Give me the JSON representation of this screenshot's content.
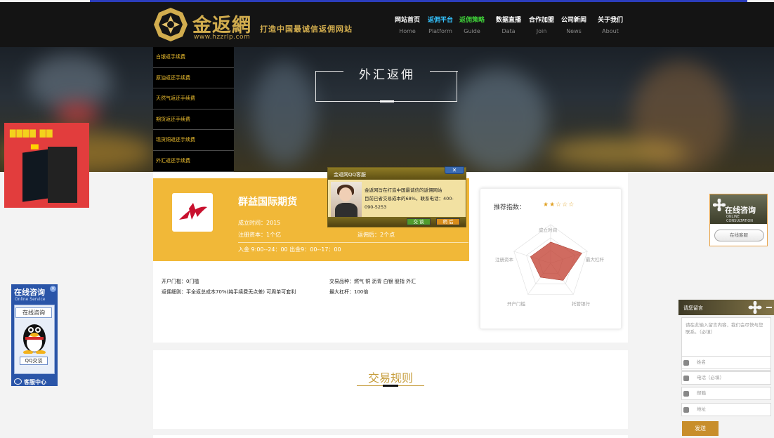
{
  "header": {
    "logo_title": "金返網",
    "logo_url": "www.hzzrlp.com",
    "slogan": "打造中国最诚信返佣网站"
  },
  "nav": [
    {
      "cn": "网站首页",
      "en": "Home"
    },
    {
      "cn": "返佣平台",
      "en": "Platform"
    },
    {
      "cn": "返佣策略",
      "en": "Guide"
    },
    {
      "cn": "数据直播",
      "en": "Data"
    },
    {
      "cn": "合作加盟",
      "en": "Join"
    },
    {
      "cn": "公司新闻",
      "en": "News"
    },
    {
      "cn": "关于我们",
      "en": "About"
    }
  ],
  "hero": {
    "title": "外汇返佣"
  },
  "side_menu": [
    "白银返手续费",
    "原油返还手续费",
    "天然气返还手续费",
    "期货返还手续费",
    "现货铜返还手续费",
    "外汇返还手续费"
  ],
  "company": {
    "name": "群益国际期货",
    "founded": "成立时间：2015",
    "capital": "注册资本：1个亿",
    "rebate": "返佣后：2个点",
    "hours": "入金 9:00--24：00 出金9：00--17：00"
  },
  "details": {
    "threshold": "开户门槛：0门槛",
    "varieties": "交易品种：燃气 铜 沥青 白银 股指 外汇",
    "rules": "返佣细则：平全返总成本70%(纯手续费无点差) 可周单可套利",
    "leverage": "最大杠杆：100倍"
  },
  "radar": {
    "title": "推荐指数：",
    "stars": "★★☆☆☆",
    "labels": [
      "成立时间",
      "最大杠杆",
      "托管银行",
      "开户门槛",
      "注册资本"
    ],
    "values": [
      0.55,
      0.85,
      0.55,
      0.45,
      0.55
    ]
  },
  "rules_section": {
    "title": "交易规则"
  },
  "qq_popup": {
    "title": "金返网QQ客服",
    "line1": "金返网旨在打造中国最诚信的返佣网站",
    "line2": "目前已省交易成本的68%，联系电话：400-090-5253",
    "btn_chat": "交 谈",
    "btn_later": "稍 后"
  },
  "qq_float": {
    "header": "在线咨询",
    "sub": "Online Service",
    "online_btn": "在线咨询",
    "qq_btn": "QQ交谈",
    "footer": "客服中心"
  },
  "right_consult": {
    "title": "在线咨询",
    "sub": "ONLINE CONSULTATION",
    "btn": "在线客服"
  },
  "leave_msg": {
    "title": "请您留言",
    "placeholder": "请在此输入留言内容，我们会尽快与您联系。（必填）",
    "name": "姓名",
    "phone": "电话（必填）",
    "email": "邮箱",
    "address": "地址",
    "send": "发送"
  },
  "colors": {
    "gold": "#f1b838",
    "dark": "#141414",
    "accent_blue": "#34c3ff",
    "accent_green": "#3fcf39",
    "radar_fill": "#c0392b"
  }
}
